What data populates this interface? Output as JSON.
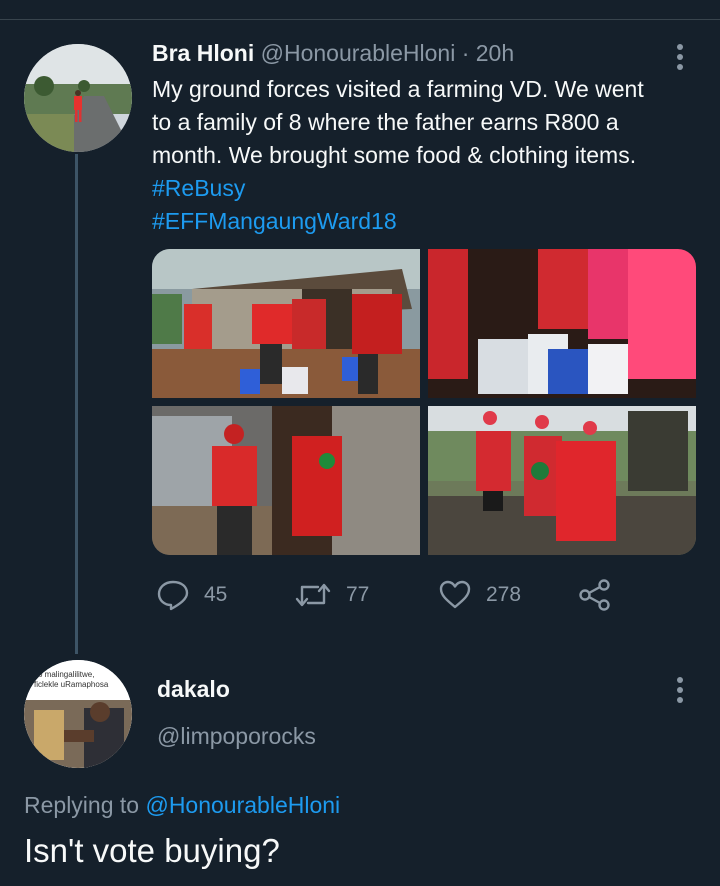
{
  "tweet": {
    "author_name": "Bra Hloni",
    "author_handle": "@HonourableHloni",
    "separator": "·",
    "time": "20h",
    "text_lines": [
      "My ground forces visited a farming VD. We went",
      "to a family of 8 where the father earns R800 a",
      "month. We brought some food & clothing items."
    ],
    "hashtags": [
      "#ReBusy",
      "#EFFMangaungWard18"
    ],
    "media": [
      {
        "alt": "EFF members in red walking to a shack carrying bags",
        "icon": "photo-icon"
      },
      {
        "alt": "Bags of food inside a dark room",
        "icon": "photo-icon"
      },
      {
        "alt": "EFF members at a zinc house door",
        "icon": "photo-icon"
      },
      {
        "alt": "Three men in red EFF blankets in a field",
        "icon": "photo-icon"
      }
    ],
    "actions": {
      "reply_count": "45",
      "retweet_count": "77",
      "like_count": "278"
    }
  },
  "reply": {
    "author_name": "dakalo",
    "author_handle": "@limpoporocks",
    "avatar_caption_line1": "so malingalilitwe,",
    "avatar_caption_line2": "ficlekle uRamaphosa",
    "replying_prefix": "Replying to",
    "replying_to": "@HonourableHloni",
    "text": "Isn't vote buying?"
  },
  "colors": {
    "background": "#15202b",
    "link": "#1d9bf0",
    "muted": "#8b98a5",
    "thread_line": "#3d5466"
  }
}
